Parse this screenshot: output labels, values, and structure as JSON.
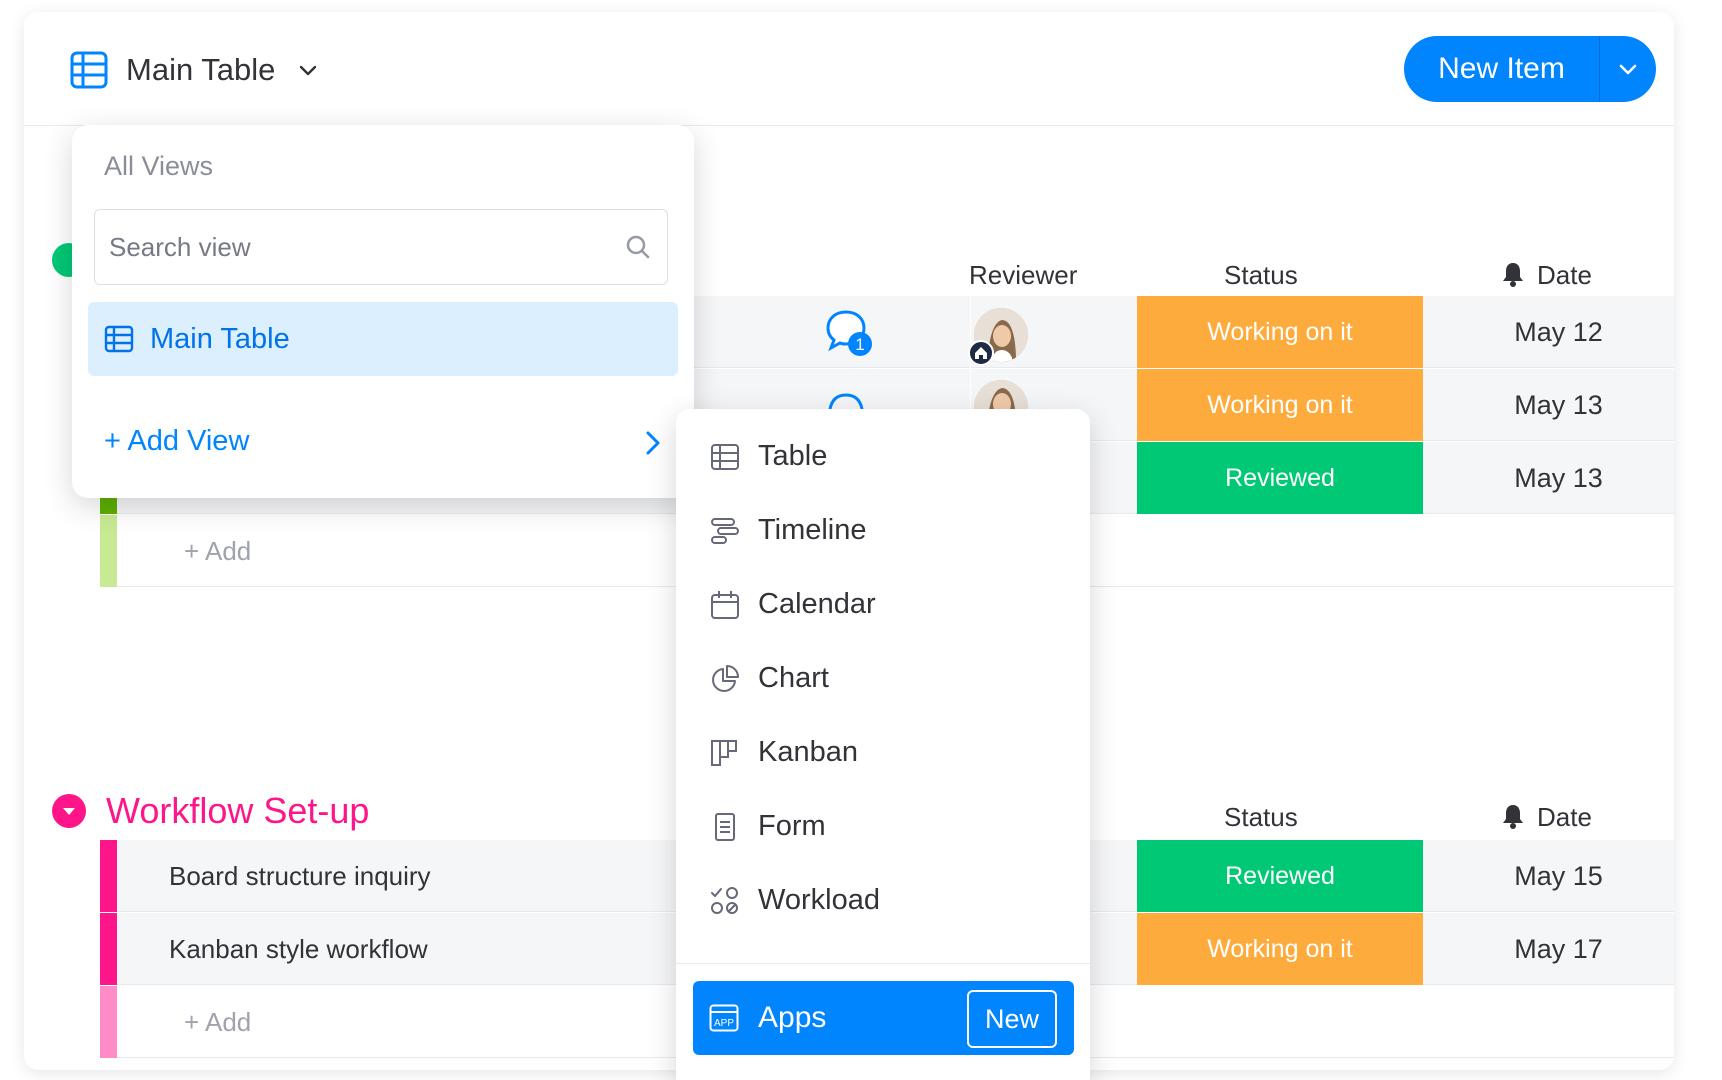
{
  "header": {
    "view_title": "Main Table",
    "new_item_label": "New Item"
  },
  "colors": {
    "primary": "#0085ff",
    "working": "#fdab3d",
    "reviewed": "#00c875",
    "group_pink": "#ff158a",
    "group_green": "#9cd326"
  },
  "columns": {
    "reviewer": "Reviewer",
    "status": "Status",
    "date": "Date"
  },
  "group1": {
    "comment_count": "1",
    "rows": [
      {
        "status": "Working on it",
        "date": "May 12"
      },
      {
        "status": "Working on it",
        "date": "May 13"
      },
      {
        "status": "Reviewed",
        "date": "May 13"
      }
    ],
    "add_label": "+ Add"
  },
  "group2": {
    "title": "Workflow Set-up",
    "columns": {
      "status": "Status",
      "date": "Date"
    },
    "rows": [
      {
        "name": "Board structure inquiry",
        "status": "Reviewed",
        "date": "May 15"
      },
      {
        "name": "Kanban style workflow",
        "status": "Working on it",
        "date": "May 17"
      }
    ],
    "add_label": "+ Add"
  },
  "views_dropdown": {
    "heading": "All Views",
    "search_placeholder": "Search view",
    "selected_view": "Main Table",
    "add_view_label": "+ Add View"
  },
  "add_view_menu": {
    "items": [
      {
        "label": "Table",
        "icon": "table-icon"
      },
      {
        "label": "Timeline",
        "icon": "timeline-icon"
      },
      {
        "label": "Calendar",
        "icon": "calendar-icon"
      },
      {
        "label": "Chart",
        "icon": "chart-icon"
      },
      {
        "label": "Kanban",
        "icon": "kanban-icon"
      },
      {
        "label": "Form",
        "icon": "form-icon"
      },
      {
        "label": "Workload",
        "icon": "workload-icon"
      }
    ],
    "apps_label": "Apps",
    "apps_badge": "New"
  }
}
